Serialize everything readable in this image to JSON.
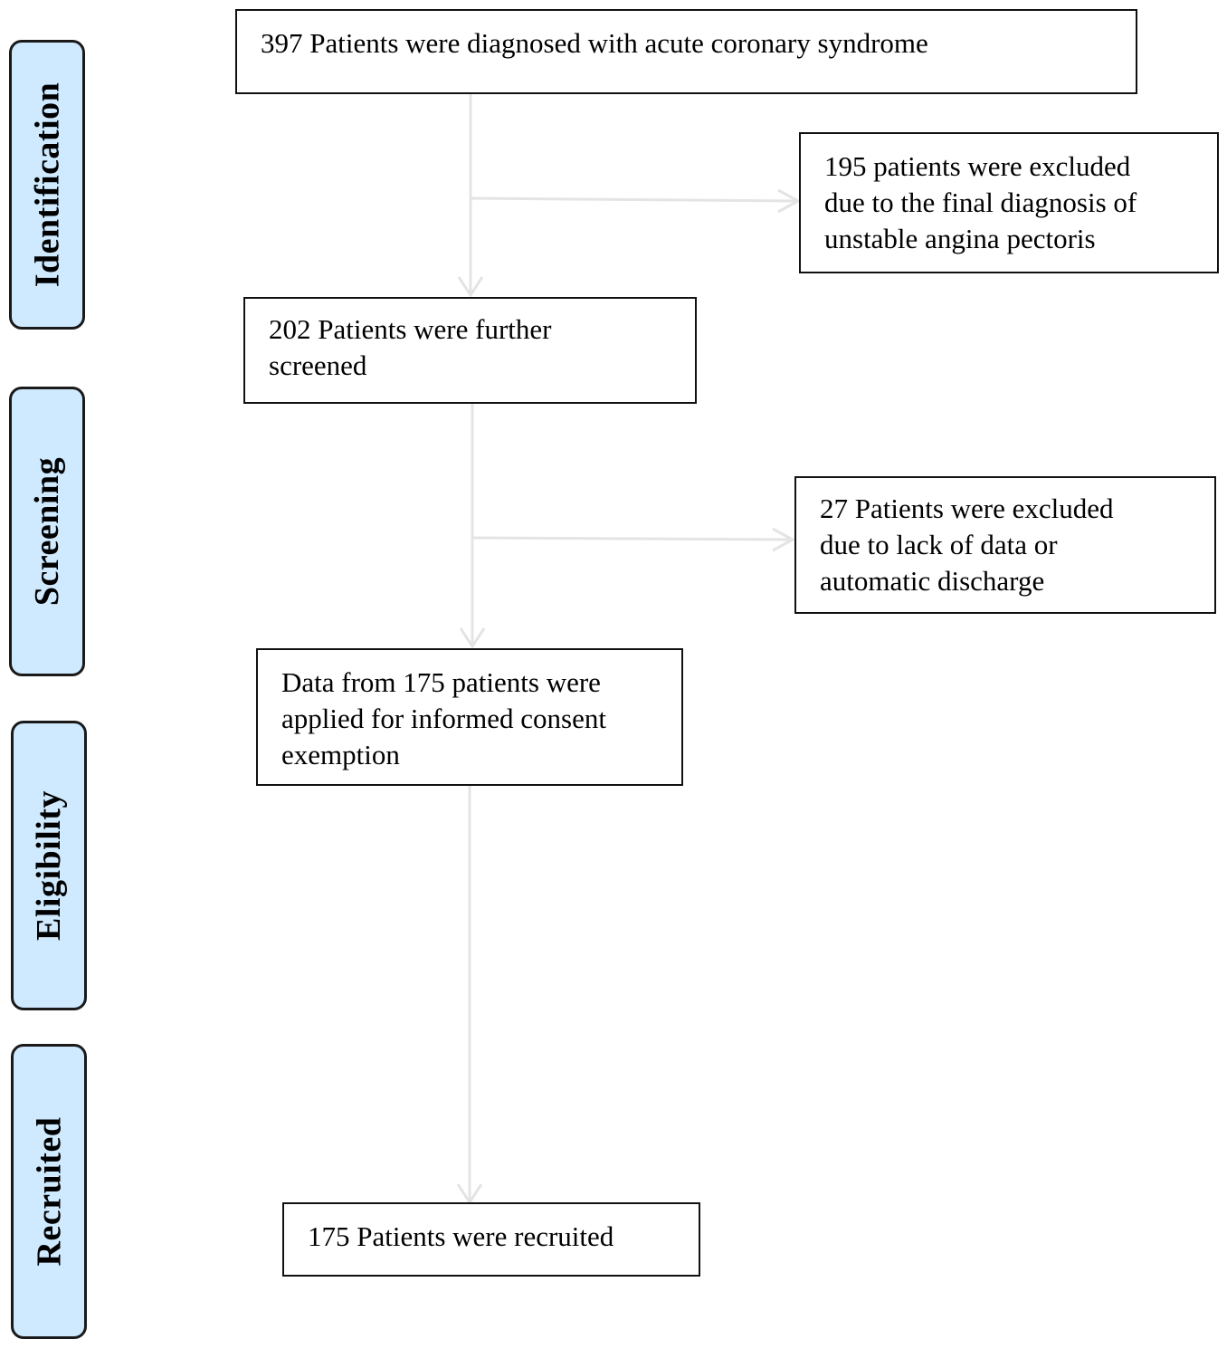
{
  "stages": [
    {
      "id": "identification",
      "label": "Identification"
    },
    {
      "id": "screening",
      "label": "Screening"
    },
    {
      "id": "eligibility",
      "label": "Eligibility"
    },
    {
      "id": "recruited",
      "label": "Recruited"
    }
  ],
  "boxes": {
    "diagnosed": {
      "lines": [
        "397 Patients were diagnosed with acute coronary syndrome"
      ]
    },
    "excluded_unstable_angina": {
      "lines": [
        "195 patients were excluded",
        "due to the final diagnosis of",
        "unstable angina pectoris"
      ]
    },
    "further_screened": {
      "lines": [
        "202 Patients were further",
        "screened"
      ]
    },
    "excluded_lack_data": {
      "lines": [
        "27 Patients were excluded",
        "due to lack of data or",
        "automatic discharge"
      ]
    },
    "consent_exemption": {
      "lines": [
        "Data from 175 patients were",
        "applied for informed consent",
        "exemption"
      ]
    },
    "recruited": {
      "lines": [
        "175 Patients were recruited"
      ]
    }
  },
  "colors": {
    "stage_fill": "#cfeaff",
    "border": "#111111",
    "arrow": "#e6e6e6"
  }
}
